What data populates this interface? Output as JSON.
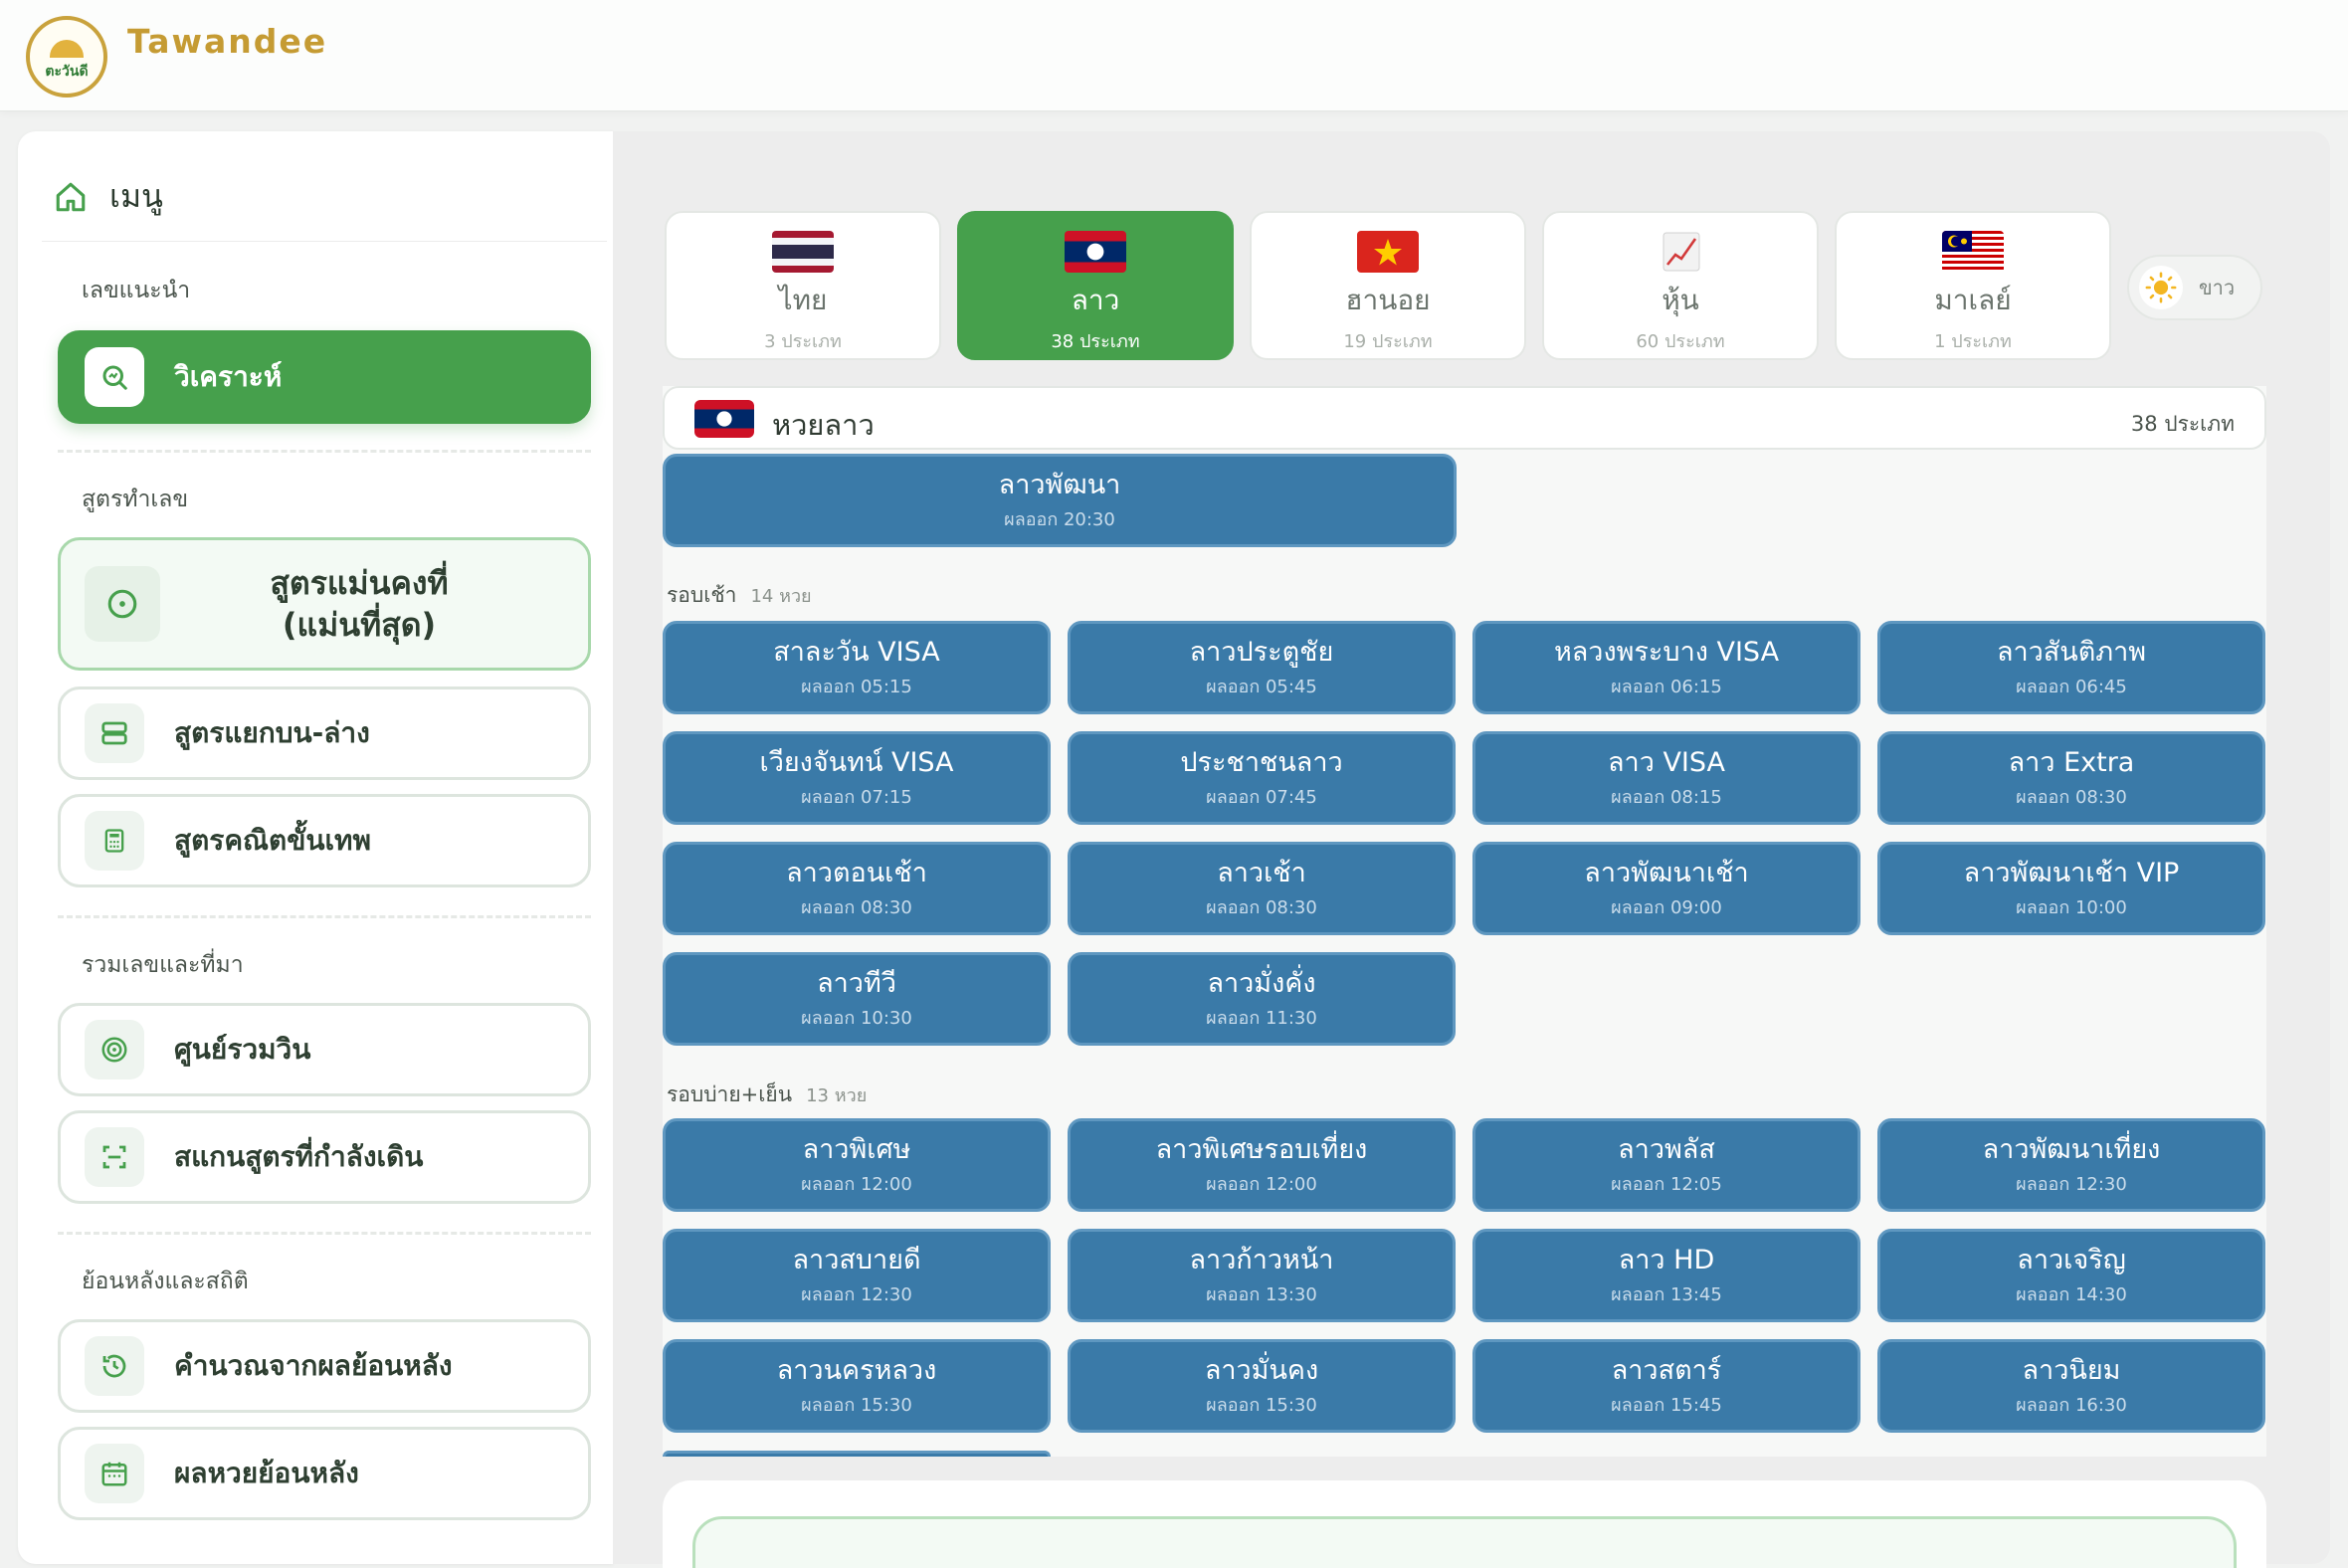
{
  "header": {
    "brand": "Tawandee",
    "logo_text": "ตะวันดี"
  },
  "sidebar": {
    "title": "เมนู",
    "sections": {
      "recommend": "เลขแนะนำ",
      "formula": "สูตรทำเลข",
      "collect": "รวมเลขและที่มา",
      "history": "ย้อนหลังและสถิติ"
    },
    "items": {
      "analyze": "วิเคราะห์",
      "stable": "สูตรแม่นคงที่\n(แม่นที่สุด)",
      "stable_l1": "สูตรแม่นคงที่",
      "stable_l2": "(แม่นที่สุด)",
      "updown": "สูตรแยกบน-ล่าง",
      "math": "สูตรคณิตขั้นเทพ",
      "win": "ศูนย์รวมวิน",
      "scan": "สแกนสูตรที่กำลังเดิน",
      "calc": "คำนวณจากผลย้อนหลัง",
      "results": "ผลหวยย้อนหลัง"
    }
  },
  "tabs": [
    {
      "name": "ไทย",
      "count": "3 ประเภท"
    },
    {
      "name": "ลาว",
      "count": "38 ประเภท"
    },
    {
      "name": "ฮานอย",
      "count": "19 ประเภท"
    },
    {
      "name": "หุ้น",
      "count": "60 ประเภท"
    },
    {
      "name": "มาเลย์",
      "count": "1 ประเภท"
    }
  ],
  "theme": {
    "label": "ขาว"
  },
  "panel": {
    "title": "หวยลาว",
    "count": "38 ประเภท"
  },
  "featured": {
    "name": "ลาวพัฒนา",
    "time": "ผลออก 20:30"
  },
  "morning": {
    "label": "รอบเช้า",
    "count": "14 หวย"
  },
  "afternoon": {
    "label": "รอบบ่าย+เย็น",
    "count": "13 หวย"
  },
  "lots_morning": [
    {
      "name": "สาละวัน VISA",
      "time": "ผลออก 05:15"
    },
    {
      "name": "ลาวประตูชัย",
      "time": "ผลออก 05:45"
    },
    {
      "name": "หลวงพระบาง VISA",
      "time": "ผลออก 06:15"
    },
    {
      "name": "ลาวสันติภาพ",
      "time": "ผลออก 06:45"
    },
    {
      "name": "เวียงจันทน์ VISA",
      "time": "ผลออก 07:15"
    },
    {
      "name": "ประชาชนลาว",
      "time": "ผลออก 07:45"
    },
    {
      "name": "ลาว VISA",
      "time": "ผลออก 08:15"
    },
    {
      "name": "ลาว Extra",
      "time": "ผลออก 08:30"
    },
    {
      "name": "ลาวตอนเช้า",
      "time": "ผลออก 08:30"
    },
    {
      "name": "ลาวเช้า",
      "time": "ผลออก 08:30"
    },
    {
      "name": "ลาวพัฒนาเช้า",
      "time": "ผลออก 09:00"
    },
    {
      "name": "ลาวพัฒนาเช้า VIP",
      "time": "ผลออก 10:00"
    },
    {
      "name": "ลาวทีวี",
      "time": "ผลออก 10:30"
    },
    {
      "name": "ลาวมั่งคั่ง",
      "time": "ผลออก 11:30"
    }
  ],
  "lots_afternoon": [
    {
      "name": "ลาวพิเศษ",
      "time": "ผลออก 12:00"
    },
    {
      "name": "ลาวพิเศษรอบเที่ยง",
      "time": "ผลออก 12:00"
    },
    {
      "name": "ลาวพลัส",
      "time": "ผลออก 12:05"
    },
    {
      "name": "ลาวพัฒนาเที่ยง",
      "time": "ผลออก 12:30"
    },
    {
      "name": "ลาวสบายดี",
      "time": "ผลออก 12:30"
    },
    {
      "name": "ลาวก้าวหน้า",
      "time": "ผลออก 13:30"
    },
    {
      "name": "ลาว HD",
      "time": "ผลออก 13:45"
    },
    {
      "name": "ลาวเจริญ",
      "time": "ผลออก 14:30"
    },
    {
      "name": "ลาวนครหลวง",
      "time": "ผลออก 15:30"
    },
    {
      "name": "ลาวมั่นคง",
      "time": "ผลออก 15:30"
    },
    {
      "name": "ลาวสตาร์",
      "time": "ผลออก 15:45"
    },
    {
      "name": "ลาวนิยม",
      "time": "ผลออก 16:30"
    }
  ],
  "colors": {
    "green": "#46a04c",
    "blue": "#3a7aa8",
    "gold": "#c59b33"
  }
}
